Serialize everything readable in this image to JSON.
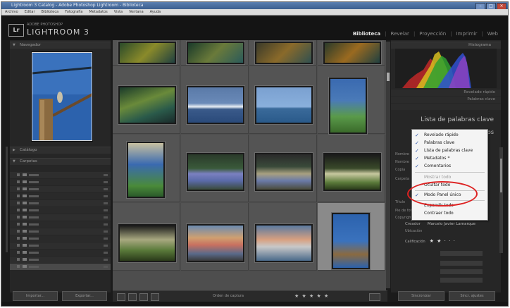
{
  "window": {
    "title": "Lightroom 3 Catalog - Adobe Photoshop Lightroom - Biblioteca"
  },
  "menubar": [
    "Archivo",
    "Editar",
    "Biblioteca",
    "Fotografía",
    "Metadatos",
    "Vista",
    "Ventana",
    "Ayuda"
  ],
  "identity": {
    "logo": "Lr",
    "subtitle": "ADOBE PHOTOSHOP",
    "app_name": "LIGHTROOM 3"
  },
  "modules": {
    "items": [
      "Biblioteca",
      "Revelar",
      "Proyección",
      "Imprimir",
      "Web"
    ],
    "separator": "|"
  },
  "left_panel": {
    "navigator": "Navegador",
    "catalog": "Catálogo",
    "folders": "Carpetas",
    "buttons": [
      "Importar...",
      "Exportar..."
    ]
  },
  "toolbar": {
    "sort_label": "Orden de captura",
    "stars": "★ ★ ★ ★ ★"
  },
  "right_panel": {
    "histogram": "Histograma",
    "rows": [
      "Revelado rápido",
      "Palabras clave"
    ],
    "keyword_list": "Lista de palabras clave",
    "metadata": "Metadatos",
    "meta_keys": [
      "Nombre",
      "Nombre",
      "Copia",
      "Carpeta",
      "Título",
      "Pie de foto",
      "Copyright",
      "Creador"
    ],
    "creator_label": "Creador",
    "creator_value": "Marcelo Javier Lamarque",
    "location": "Ubicación",
    "rating_label": "Calificación",
    "rating_stars": "★ ★ · · ·",
    "buttons": [
      "Sincronizar",
      "Sincr. ajustes"
    ]
  },
  "context_menu": {
    "items": [
      {
        "label": "Revelado rápido",
        "checked": true,
        "enabled": true
      },
      {
        "label": "Palabras clave",
        "checked": true,
        "enabled": true
      },
      {
        "label": "Lista de palabras clave",
        "checked": true,
        "enabled": true
      },
      {
        "label": "Metadatos *",
        "checked": true,
        "enabled": true
      },
      {
        "label": "Comentarios",
        "checked": true,
        "enabled": true
      },
      {
        "label": "Mostrar todo",
        "checked": false,
        "enabled": false
      },
      {
        "label": "Ocultar todo",
        "checked": false,
        "enabled": true
      },
      {
        "label": "Modo Panel único",
        "checked": true,
        "enabled": true
      },
      {
        "label": "Expandir todo",
        "checked": false,
        "enabled": true
      },
      {
        "label": "Contraer todo",
        "checked": false,
        "enabled": true
      }
    ],
    "check_glyph": "✓",
    "highlight_color": "#dd2222"
  }
}
